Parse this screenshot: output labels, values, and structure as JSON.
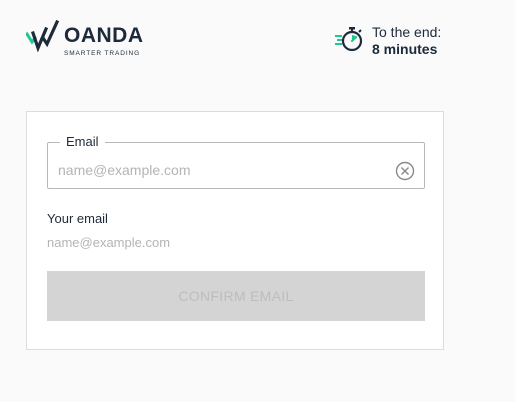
{
  "header": {
    "logo": {
      "name": "OANDA",
      "tagline": "SMARTER TRADING"
    },
    "timer": {
      "icon": "stopwatch-icon",
      "label": "To the end:",
      "value": "8 minutes"
    }
  },
  "form": {
    "email_field": {
      "legend": "Email",
      "value": "",
      "placeholder": "name@example.com",
      "clear_icon": "clear-circle-x-icon"
    },
    "your_email": {
      "label": "Your email",
      "value": "name@example.com"
    },
    "confirm_button": {
      "label": "CONFIRM EMAIL",
      "disabled": true
    }
  },
  "colors": {
    "brand_dark": "#1c2a3a",
    "brand_green": "#1fc98a",
    "button_disabled_bg": "#d4d4d4",
    "button_disabled_text": "#bdbdbd",
    "placeholder": "#b4b4b4"
  }
}
